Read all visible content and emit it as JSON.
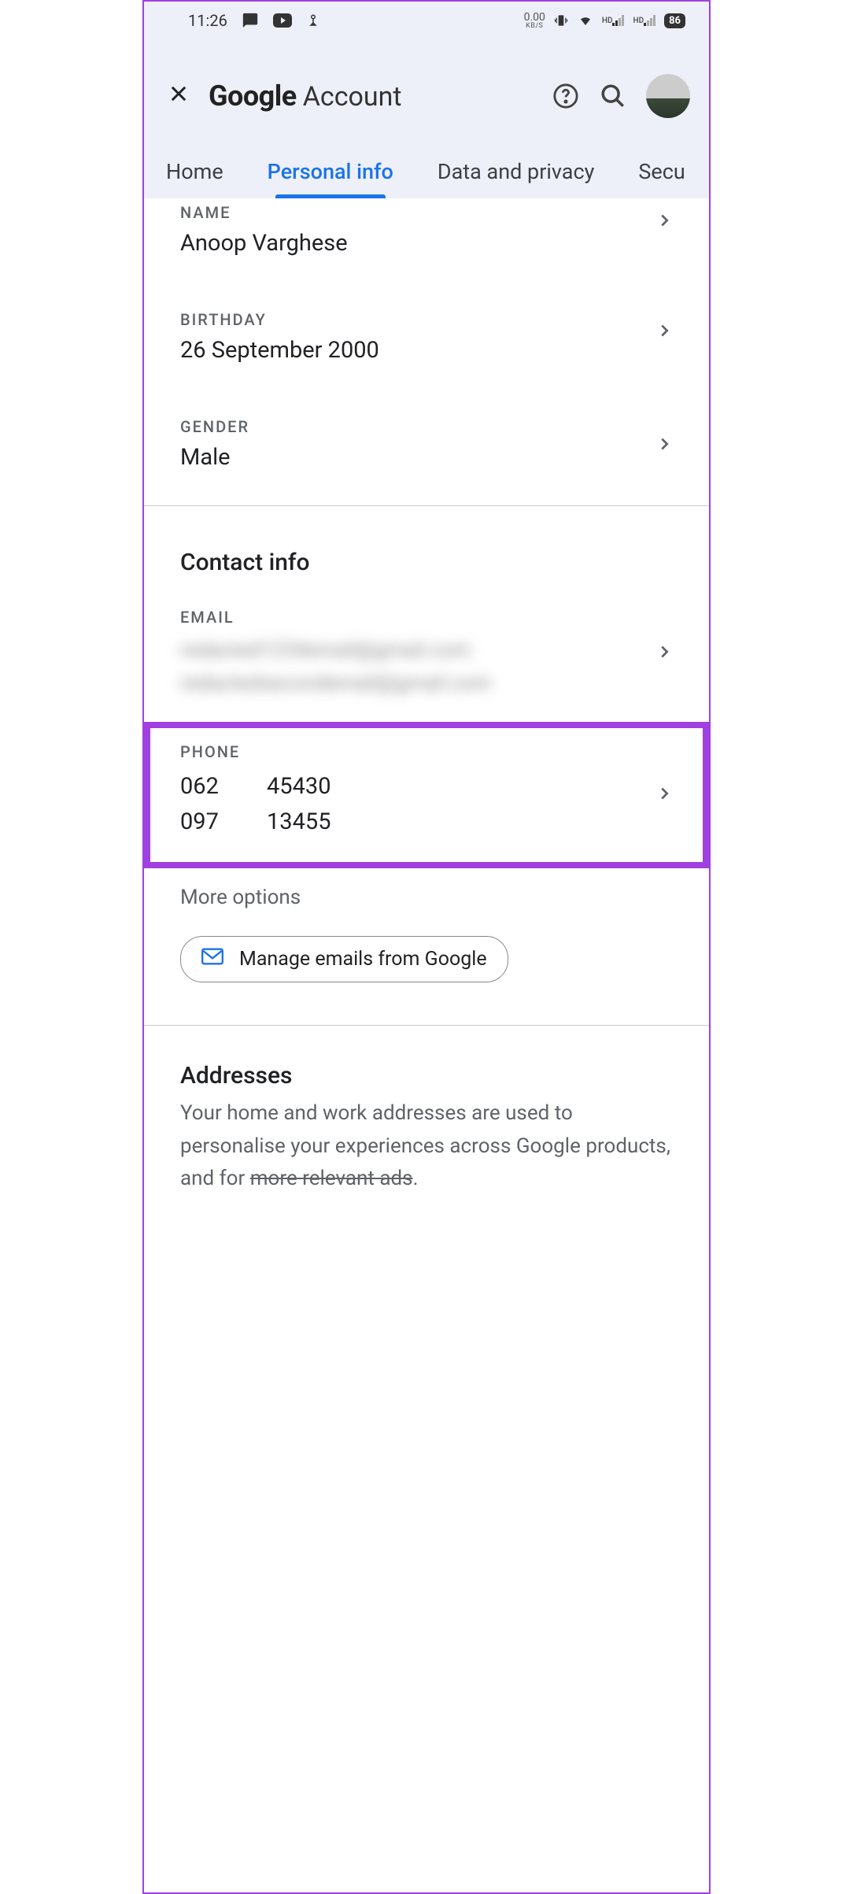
{
  "status": {
    "time": "11:26",
    "data_rate": "0.00",
    "data_unit": "KB/S",
    "battery": "86"
  },
  "header": {
    "logo": "Google",
    "title": "Account"
  },
  "tabs": {
    "home": "Home",
    "personal": "Personal info",
    "privacy": "Data and privacy",
    "security": "Secu"
  },
  "basic": {
    "name_label": "NAME",
    "name_value": "Anoop Varghese",
    "birthday_label": "BIRTHDAY",
    "birthday_value": "26 September 2000",
    "gender_label": "GENDER",
    "gender_value": "Male"
  },
  "contact": {
    "title": "Contact info",
    "email_label": "EMAIL",
    "email_blur1": "redacted1234email@gmail.com",
    "email_blur2": "redactedsecondemail@gmail.com",
    "phone_label": "PHONE",
    "phone1a": "062",
    "phone1b": "45430",
    "phone2a": "097",
    "phone2b": "13455",
    "more": "More options",
    "manage": "Manage emails from Google"
  },
  "addresses": {
    "title": "Addresses",
    "desc1": "Your home and work addresses are used to personalise your experiences across Google products, and for ",
    "desc_strike": "more relevant ads",
    "desc_end": "."
  }
}
